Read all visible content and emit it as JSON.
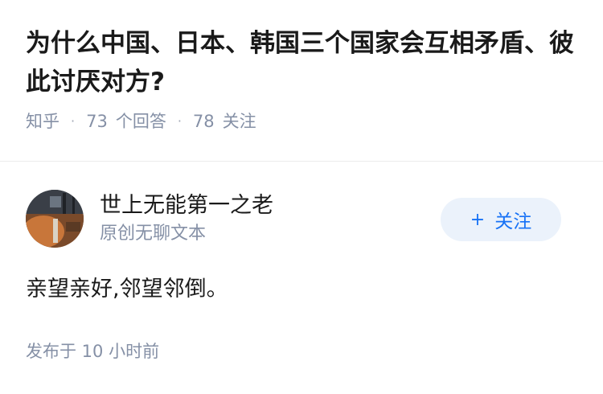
{
  "question": {
    "title": "为什么中国、日本、韩国三个国家会互相矛盾、彼此讨厌对方?",
    "source": "知乎",
    "answer_count": "73",
    "answer_label": "个回答",
    "follow_count": "78",
    "follow_label": "关注"
  },
  "answer": {
    "author_name": "世上无能第一之老",
    "author_bio": "原创无聊文本",
    "follow_button_label": "关注",
    "follow_button_icon": "plus-icon",
    "content": "亲望亲好,邻望邻倒。",
    "publish_time": "发布于 10 小时前"
  },
  "colors": {
    "accent": "#1772f6",
    "follow_bg": "#ebf2fb",
    "meta_gray": "#8590a6"
  }
}
